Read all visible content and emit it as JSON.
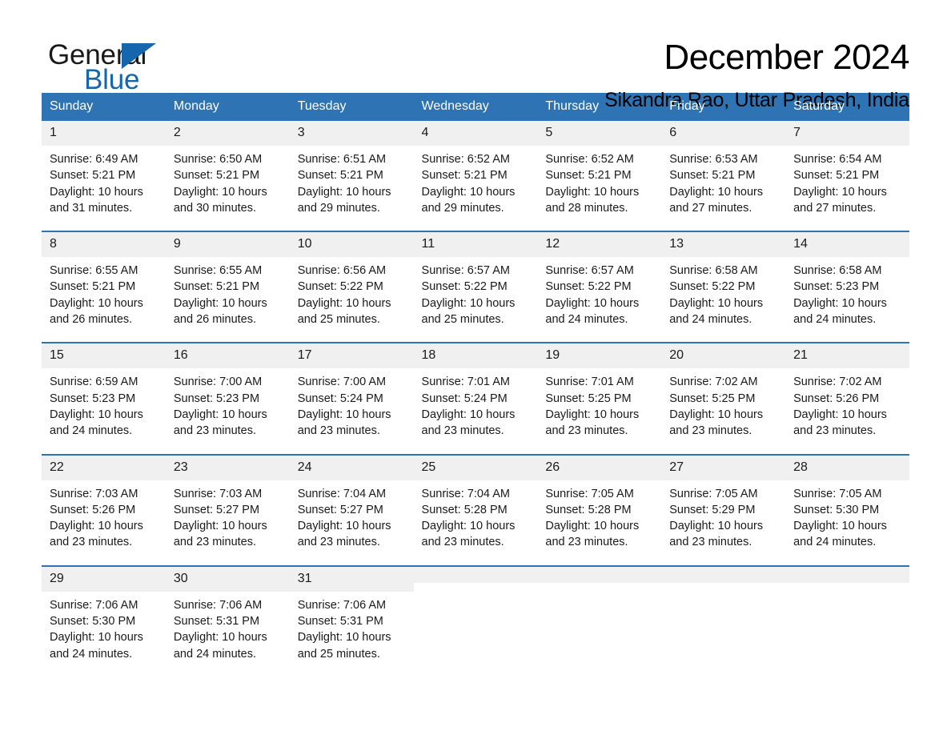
{
  "brand": {
    "name_part1": "General",
    "name_part2": "Blue",
    "triangle_color": "#1566ad"
  },
  "header": {
    "month_title": "December 2024",
    "location": "Sikandra Rao, Uttar Pradesh, India"
  },
  "theme": {
    "header_blue": "#2e74b5",
    "daynum_band": "#f0f0f0",
    "text": "#1a1a1a"
  },
  "weekday_headers": [
    "Sunday",
    "Monday",
    "Tuesday",
    "Wednesday",
    "Thursday",
    "Friday",
    "Saturday"
  ],
  "weeks": [
    [
      {
        "day": "1",
        "sunrise": "Sunrise: 6:49 AM",
        "sunset": "Sunset: 5:21 PM",
        "daylight_line1": "Daylight: 10 hours",
        "daylight_line2": "and 31 minutes."
      },
      {
        "day": "2",
        "sunrise": "Sunrise: 6:50 AM",
        "sunset": "Sunset: 5:21 PM",
        "daylight_line1": "Daylight: 10 hours",
        "daylight_line2": "and 30 minutes."
      },
      {
        "day": "3",
        "sunrise": "Sunrise: 6:51 AM",
        "sunset": "Sunset: 5:21 PM",
        "daylight_line1": "Daylight: 10 hours",
        "daylight_line2": "and 29 minutes."
      },
      {
        "day": "4",
        "sunrise": "Sunrise: 6:52 AM",
        "sunset": "Sunset: 5:21 PM",
        "daylight_line1": "Daylight: 10 hours",
        "daylight_line2": "and 29 minutes."
      },
      {
        "day": "5",
        "sunrise": "Sunrise: 6:52 AM",
        "sunset": "Sunset: 5:21 PM",
        "daylight_line1": "Daylight: 10 hours",
        "daylight_line2": "and 28 minutes."
      },
      {
        "day": "6",
        "sunrise": "Sunrise: 6:53 AM",
        "sunset": "Sunset: 5:21 PM",
        "daylight_line1": "Daylight: 10 hours",
        "daylight_line2": "and 27 minutes."
      },
      {
        "day": "7",
        "sunrise": "Sunrise: 6:54 AM",
        "sunset": "Sunset: 5:21 PM",
        "daylight_line1": "Daylight: 10 hours",
        "daylight_line2": "and 27 minutes."
      }
    ],
    [
      {
        "day": "8",
        "sunrise": "Sunrise: 6:55 AM",
        "sunset": "Sunset: 5:21 PM",
        "daylight_line1": "Daylight: 10 hours",
        "daylight_line2": "and 26 minutes."
      },
      {
        "day": "9",
        "sunrise": "Sunrise: 6:55 AM",
        "sunset": "Sunset: 5:21 PM",
        "daylight_line1": "Daylight: 10 hours",
        "daylight_line2": "and 26 minutes."
      },
      {
        "day": "10",
        "sunrise": "Sunrise: 6:56 AM",
        "sunset": "Sunset: 5:22 PM",
        "daylight_line1": "Daylight: 10 hours",
        "daylight_line2": "and 25 minutes."
      },
      {
        "day": "11",
        "sunrise": "Sunrise: 6:57 AM",
        "sunset": "Sunset: 5:22 PM",
        "daylight_line1": "Daylight: 10 hours",
        "daylight_line2": "and 25 minutes."
      },
      {
        "day": "12",
        "sunrise": "Sunrise: 6:57 AM",
        "sunset": "Sunset: 5:22 PM",
        "daylight_line1": "Daylight: 10 hours",
        "daylight_line2": "and 24 minutes."
      },
      {
        "day": "13",
        "sunrise": "Sunrise: 6:58 AM",
        "sunset": "Sunset: 5:22 PM",
        "daylight_line1": "Daylight: 10 hours",
        "daylight_line2": "and 24 minutes."
      },
      {
        "day": "14",
        "sunrise": "Sunrise: 6:58 AM",
        "sunset": "Sunset: 5:23 PM",
        "daylight_line1": "Daylight: 10 hours",
        "daylight_line2": "and 24 minutes."
      }
    ],
    [
      {
        "day": "15",
        "sunrise": "Sunrise: 6:59 AM",
        "sunset": "Sunset: 5:23 PM",
        "daylight_line1": "Daylight: 10 hours",
        "daylight_line2": "and 24 minutes."
      },
      {
        "day": "16",
        "sunrise": "Sunrise: 7:00 AM",
        "sunset": "Sunset: 5:23 PM",
        "daylight_line1": "Daylight: 10 hours",
        "daylight_line2": "and 23 minutes."
      },
      {
        "day": "17",
        "sunrise": "Sunrise: 7:00 AM",
        "sunset": "Sunset: 5:24 PM",
        "daylight_line1": "Daylight: 10 hours",
        "daylight_line2": "and 23 minutes."
      },
      {
        "day": "18",
        "sunrise": "Sunrise: 7:01 AM",
        "sunset": "Sunset: 5:24 PM",
        "daylight_line1": "Daylight: 10 hours",
        "daylight_line2": "and 23 minutes."
      },
      {
        "day": "19",
        "sunrise": "Sunrise: 7:01 AM",
        "sunset": "Sunset: 5:25 PM",
        "daylight_line1": "Daylight: 10 hours",
        "daylight_line2": "and 23 minutes."
      },
      {
        "day": "20",
        "sunrise": "Sunrise: 7:02 AM",
        "sunset": "Sunset: 5:25 PM",
        "daylight_line1": "Daylight: 10 hours",
        "daylight_line2": "and 23 minutes."
      },
      {
        "day": "21",
        "sunrise": "Sunrise: 7:02 AM",
        "sunset": "Sunset: 5:26 PM",
        "daylight_line1": "Daylight: 10 hours",
        "daylight_line2": "and 23 minutes."
      }
    ],
    [
      {
        "day": "22",
        "sunrise": "Sunrise: 7:03 AM",
        "sunset": "Sunset: 5:26 PM",
        "daylight_line1": "Daylight: 10 hours",
        "daylight_line2": "and 23 minutes."
      },
      {
        "day": "23",
        "sunrise": "Sunrise: 7:03 AM",
        "sunset": "Sunset: 5:27 PM",
        "daylight_line1": "Daylight: 10 hours",
        "daylight_line2": "and 23 minutes."
      },
      {
        "day": "24",
        "sunrise": "Sunrise: 7:04 AM",
        "sunset": "Sunset: 5:27 PM",
        "daylight_line1": "Daylight: 10 hours",
        "daylight_line2": "and 23 minutes."
      },
      {
        "day": "25",
        "sunrise": "Sunrise: 7:04 AM",
        "sunset": "Sunset: 5:28 PM",
        "daylight_line1": "Daylight: 10 hours",
        "daylight_line2": "and 23 minutes."
      },
      {
        "day": "26",
        "sunrise": "Sunrise: 7:05 AM",
        "sunset": "Sunset: 5:28 PM",
        "daylight_line1": "Daylight: 10 hours",
        "daylight_line2": "and 23 minutes."
      },
      {
        "day": "27",
        "sunrise": "Sunrise: 7:05 AM",
        "sunset": "Sunset: 5:29 PM",
        "daylight_line1": "Daylight: 10 hours",
        "daylight_line2": "and 23 minutes."
      },
      {
        "day": "28",
        "sunrise": "Sunrise: 7:05 AM",
        "sunset": "Sunset: 5:30 PM",
        "daylight_line1": "Daylight: 10 hours",
        "daylight_line2": "and 24 minutes."
      }
    ],
    [
      {
        "day": "29",
        "sunrise": "Sunrise: 7:06 AM",
        "sunset": "Sunset: 5:30 PM",
        "daylight_line1": "Daylight: 10 hours",
        "daylight_line2": "and 24 minutes."
      },
      {
        "day": "30",
        "sunrise": "Sunrise: 7:06 AM",
        "sunset": "Sunset: 5:31 PM",
        "daylight_line1": "Daylight: 10 hours",
        "daylight_line2": "and 24 minutes."
      },
      {
        "day": "31",
        "sunrise": "Sunrise: 7:06 AM",
        "sunset": "Sunset: 5:31 PM",
        "daylight_line1": "Daylight: 10 hours",
        "daylight_line2": "and 25 minutes."
      },
      {
        "day": "",
        "sunrise": "",
        "sunset": "",
        "daylight_line1": "",
        "daylight_line2": ""
      },
      {
        "day": "",
        "sunrise": "",
        "sunset": "",
        "daylight_line1": "",
        "daylight_line2": ""
      },
      {
        "day": "",
        "sunrise": "",
        "sunset": "",
        "daylight_line1": "",
        "daylight_line2": ""
      },
      {
        "day": "",
        "sunrise": "",
        "sunset": "",
        "daylight_line1": "",
        "daylight_line2": ""
      }
    ]
  ]
}
